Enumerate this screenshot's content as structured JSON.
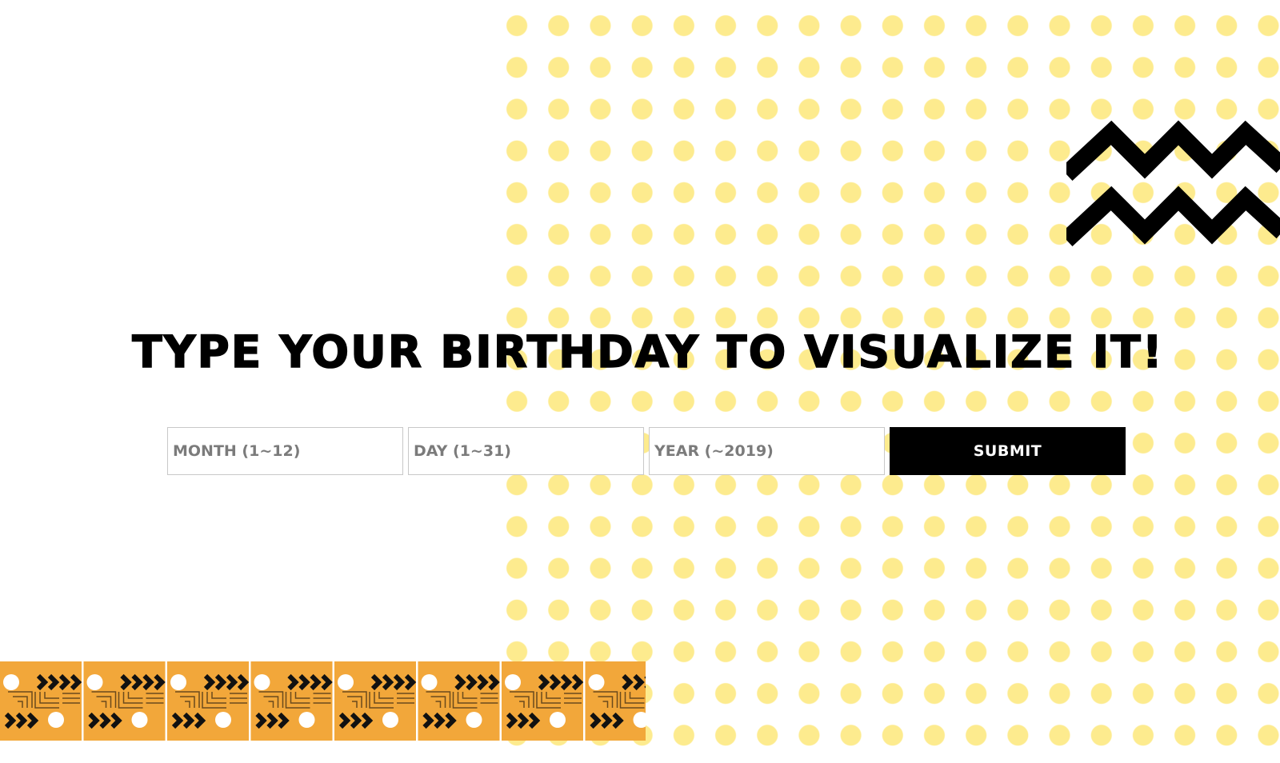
{
  "heading": {
    "text": "TYPE YOUR BIRTHDAY TO VISUALIZE IT!"
  },
  "form": {
    "month_placeholder": "MONTH (1~12)",
    "day_placeholder": "DAY (1~31)",
    "year_placeholder": "YEAR (~2019)",
    "submit_label": "SUBMIT"
  },
  "decor": {
    "dot_color": "#fdeb8e",
    "ribbon_color": "#f2a73a",
    "zigzag_color": "#000000",
    "icons": [
      "polka-dot-background",
      "zigzag-shape",
      "patterned-ribbon"
    ]
  }
}
